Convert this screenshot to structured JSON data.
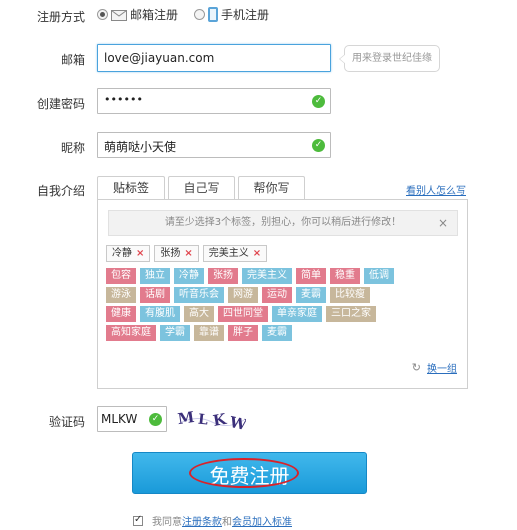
{
  "register_method": {
    "label": "注册方式",
    "options": [
      {
        "label": "邮箱注册",
        "selected": true
      },
      {
        "label": "手机注册",
        "selected": false
      }
    ]
  },
  "email": {
    "label": "邮箱",
    "value": "love@jiayuan.com",
    "hint": "用来登录世纪佳缘"
  },
  "password": {
    "label": "创建密码",
    "value": "••••••"
  },
  "nickname": {
    "label": "昵称",
    "value": "萌萌哒小天使"
  },
  "intro": {
    "label": "自我介绍",
    "tabs": [
      "贴标签",
      "自己写",
      "帮你写"
    ],
    "active_tab": "贴标签",
    "see_others": "看别人怎么写",
    "notice": "请至少选择3个标签，别担心，你可以稍后进行修改！",
    "notice_close": "×",
    "selected_tags": [
      "冷静",
      "张扬",
      "完美主义"
    ],
    "remove_symbol": "×",
    "tag_rows": [
      [
        {
          "t": "包容",
          "c": "pink"
        },
        {
          "t": "独立",
          "c": "blue"
        },
        {
          "t": "冷静",
          "c": "blue"
        },
        {
          "t": "张扬",
          "c": "pink"
        },
        {
          "t": "完美主义",
          "c": "blue"
        },
        {
          "t": "简单",
          "c": "pink"
        },
        {
          "t": "稳重",
          "c": "pink"
        },
        {
          "t": "低调",
          "c": "blue"
        }
      ],
      [
        {
          "t": "游泳",
          "c": "khaki"
        },
        {
          "t": "话剧",
          "c": "pink"
        },
        {
          "t": "听音乐会",
          "c": "blue"
        },
        {
          "t": "网游",
          "c": "khaki"
        },
        {
          "t": "运动",
          "c": "pink"
        },
        {
          "t": "麦霸",
          "c": "blue"
        },
        {
          "t": "比较瘦",
          "c": "khaki"
        }
      ],
      [
        {
          "t": "健康",
          "c": "pink"
        },
        {
          "t": "有腹肌",
          "c": "blue"
        },
        {
          "t": "高大",
          "c": "khaki"
        },
        {
          "t": "四世同堂",
          "c": "pink"
        },
        {
          "t": "单亲家庭",
          "c": "blue"
        },
        {
          "t": "三口之家",
          "c": "khaki"
        }
      ],
      [
        {
          "t": "高知家庭",
          "c": "pink"
        },
        {
          "t": "学霸",
          "c": "blue"
        },
        {
          "t": "靠谱",
          "c": "khaki"
        },
        {
          "t": "胖子",
          "c": "pink"
        },
        {
          "t": "麦霸",
          "c": "blue"
        }
      ]
    ],
    "refresh": "换一组"
  },
  "captcha": {
    "label": "验证码",
    "value": "MLKW",
    "image_text": "M L K W"
  },
  "submit": {
    "label": "免费注册"
  },
  "agreement": {
    "prefix": "我同意",
    "terms": "注册条款",
    "and": "和",
    "standard": "会员加入标准"
  },
  "colors": {
    "accent": "#1a9ad9",
    "check": "#4dbb3c",
    "tag_pink": "#e27b8d",
    "tag_blue": "#7cc3de",
    "tag_khaki": "#c7b79b",
    "link": "#2a6ebd",
    "highlight": "#d8232a"
  }
}
